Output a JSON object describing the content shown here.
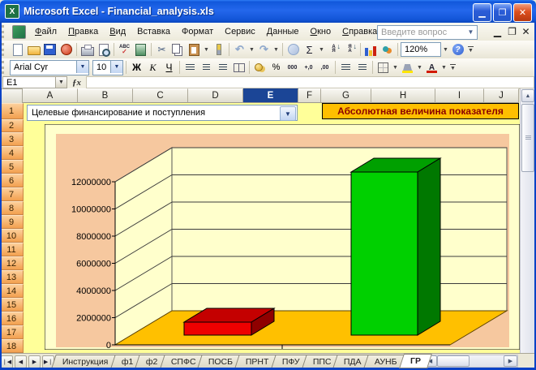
{
  "window": {
    "title": "Microsoft Excel - Financial_analysis.xls"
  },
  "menu": {
    "items": [
      {
        "label": "Файл"
      },
      {
        "label": "Правка"
      },
      {
        "label": "Вид"
      },
      {
        "label": "Вставка"
      },
      {
        "label": "Формат"
      },
      {
        "label": "Сервис"
      },
      {
        "label": "Данные"
      },
      {
        "label": "Окно"
      },
      {
        "label": "Справка"
      }
    ],
    "question_placeholder": "Введите вопрос"
  },
  "toolbar_standard": {
    "spelling_label": "ABC",
    "spelling_check": "✓",
    "undo_glyph": "↶",
    "redo_glyph": "↷",
    "cut_glyph": "✂",
    "autosum_label": "Σ",
    "sort_asc_top": "А",
    "sort_asc_bottom": "Я",
    "sort_desc_top": "Я",
    "sort_desc_bottom": "А",
    "sort_arrow": "↓",
    "zoom_value": "120%",
    "help_glyph": "?"
  },
  "toolbar_formatting": {
    "font_name": "Arial Cyr",
    "font_size": "10",
    "bold_label": "Ж",
    "italic_label": "К",
    "underline_label": "Ч",
    "percent_label": "%",
    "thousands_label": "000",
    "increase_decimal_label": "+,0",
    "decrease_decimal_label": ",00",
    "font_color_letter": "А"
  },
  "formula_bar": {
    "name_box": "E1",
    "fx_label": "ƒx",
    "formula_value": ""
  },
  "sheet": {
    "columns": [
      "A",
      "B",
      "C",
      "D",
      "E",
      "F",
      "G",
      "H",
      "I",
      "J"
    ],
    "selected_column": "E",
    "rows": [
      "1",
      "2",
      "3",
      "4",
      "5",
      "6",
      "7",
      "8",
      "9",
      "10",
      "11",
      "12",
      "13",
      "14",
      "15",
      "16",
      "17",
      "18"
    ],
    "combobox_value": "Целевые финансирование и поступления",
    "title_cell": "Абсолютная величина показателя"
  },
  "chart_data": {
    "type": "bar",
    "subtype": "3d-column",
    "title": "",
    "xlabel": "",
    "ylabel": "",
    "categories": [
      "",
      ""
    ],
    "series": [
      {
        "name": "Целевые финансирование и поступления",
        "values": [
          1400000,
          12250000
        ]
      }
    ],
    "ylim": [
      0,
      12000000
    ],
    "ytick_step": 2000000,
    "y_ticks": [
      "12000000",
      "10000000",
      "8000000",
      "6000000",
      "4000000",
      "2000000",
      "0"
    ],
    "grid": true,
    "legend": "none",
    "bar_colors": [
      "#EE0000",
      "#00CC00"
    ],
    "wall_color": "#FFFFCC",
    "floor_color": "#FFC000",
    "backdrop_color": "#F6C89F"
  },
  "tabs": {
    "labels": [
      "Инструкция",
      "ф1",
      "ф2",
      "СПФС",
      "ПОСБ",
      "ПРНТ",
      "ПФУ",
      "ППС",
      "ПДА",
      "АУНБ",
      "ГР"
    ],
    "active": "ГР"
  }
}
